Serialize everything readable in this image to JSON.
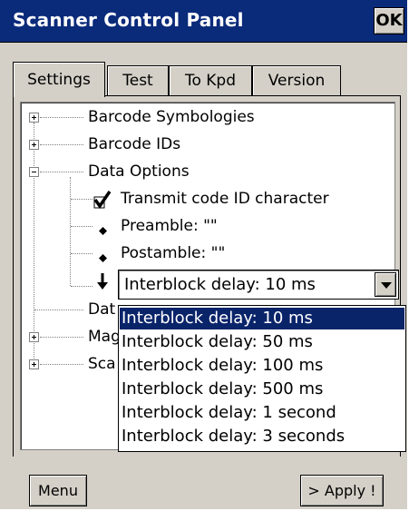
{
  "window": {
    "title": "Scanner Control Panel",
    "ok_label": "OK"
  },
  "tabs": [
    {
      "label": "Settings",
      "active": true
    },
    {
      "label": "Test",
      "active": false
    },
    {
      "label": "To Kpd",
      "active": false
    },
    {
      "label": "Version",
      "active": false
    }
  ],
  "tree": {
    "items": [
      {
        "label": "Barcode Symbologies",
        "expander": "plus"
      },
      {
        "label": "Barcode IDs",
        "expander": "plus"
      },
      {
        "label": "Data Options",
        "expander": "minus"
      },
      {
        "label": "Transmit code ID character",
        "icon": "checkmark-icon"
      },
      {
        "label": "Preamble: \"\"",
        "icon": "diamond-bullet-icon"
      },
      {
        "label": "Postamble: \"\"",
        "icon": "diamond-bullet-icon"
      },
      {
        "label": "Dat",
        "expander": "none"
      },
      {
        "label": "Mag",
        "expander": "plus"
      },
      {
        "label": "Sca",
        "expander": "plus"
      }
    ]
  },
  "combo": {
    "value": "Interblock delay: 10 ms",
    "options": [
      "Interblock delay: 10 ms",
      "Interblock delay: 50 ms",
      "Interblock delay: 100 ms",
      "Interblock delay: 500 ms",
      "Interblock delay: 1 second",
      "Interblock delay: 3 seconds"
    ],
    "selected_index": 0
  },
  "footer": {
    "menu_label": "Menu",
    "apply_label": "> Apply !"
  },
  "colors": {
    "titlebar": "#0a2a7a",
    "selection": "#0a246a",
    "face": "#d4d0c8"
  }
}
